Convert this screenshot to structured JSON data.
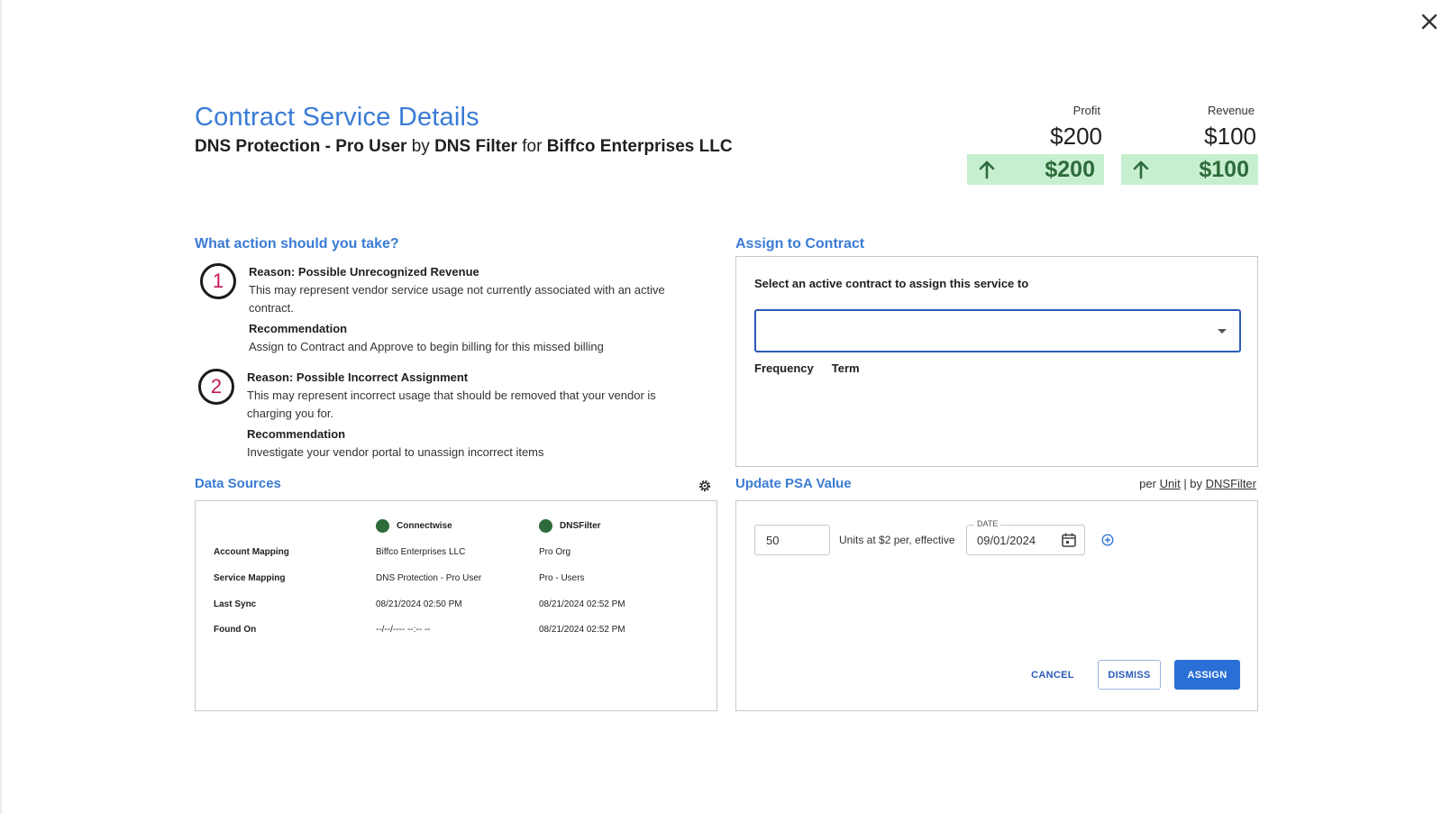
{
  "header": {
    "title": "Contract Service Details",
    "service_name": "DNS Protection - Pro User",
    "by_word": "by",
    "vendor": "DNS Filter",
    "for_word": "for",
    "customer": "Biffco Enterprises LLC"
  },
  "metrics": {
    "profit": {
      "label": "Profit",
      "value": "$200",
      "delta": "$200"
    },
    "revenue": {
      "label": "Revenue",
      "value": "$100",
      "delta": "$100"
    }
  },
  "actions": {
    "title": "What action should you take?",
    "items": [
      {
        "number": "1",
        "reason": "Reason: Possible Unrecognized Revenue",
        "description": "This may represent vendor service usage not currently associated with an active contract.",
        "rec_label": "Recommendation",
        "recommendation": "Assign to Contract and Approve to begin billing for this missed billing"
      },
      {
        "number": "2",
        "reason": "Reason: Possible Incorrect Assignment",
        "description": "This may represent incorrect usage that should be removed that your vendor is charging you for.",
        "rec_label": "Recommendation",
        "recommendation": "Investigate your vendor portal to unassign incorrect items"
      }
    ]
  },
  "assign": {
    "title": "Assign to Contract",
    "instruction": "Select an active contract to assign this service to",
    "contract_value": "",
    "frequency_label": "Frequency",
    "term_label": "Term"
  },
  "data_sources": {
    "title": "Data Sources",
    "columns": [
      "Connectwise",
      "DNSFilter"
    ],
    "source_color": "#2e6b3a",
    "rows": [
      {
        "label": "Account Mapping",
        "values": [
          "Biffco Enterprises LLC",
          "Pro Org"
        ]
      },
      {
        "label": "Service Mapping",
        "values": [
          "DNS Protection - Pro User",
          "Pro - Users"
        ]
      },
      {
        "label": "Last Sync",
        "values": [
          "08/21/2024 02:50 PM",
          "08/21/2024 02:52 PM"
        ]
      },
      {
        "label": "Found On",
        "values": [
          "--/--/---- --:-- --",
          "08/21/2024 02:52 PM"
        ]
      }
    ]
  },
  "psa": {
    "title": "Update PSA Value",
    "per_label": "per",
    "unit_link": "Unit",
    "by_label": "| by",
    "vendor_link": "DNSFilter",
    "units_value": "50",
    "units_text": "Units at $2 per, effective",
    "date_label": "DATE",
    "date_value": "09/01/2024"
  },
  "buttons": {
    "cancel": "CANCEL",
    "dismiss": "DISMISS",
    "assign": "ASSIGN"
  },
  "colors": {
    "accent": "#3a7bd5",
    "primary_button": "#2a6fd6",
    "delta_bg": "#c6efcf",
    "delta_text": "#2e6b3a"
  }
}
